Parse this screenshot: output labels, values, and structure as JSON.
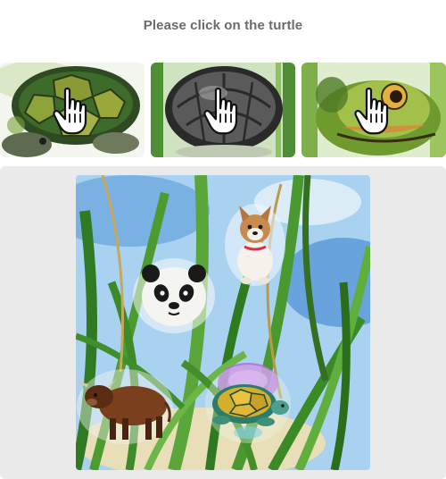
{
  "captcha": {
    "instruction": "Please click on the turtle"
  },
  "example_tiles": [
    {
      "icon": "turtle-shell-green-example",
      "cursor_icon": "hand-pointer-icon"
    },
    {
      "icon": "turtle-shell-grey-example",
      "cursor_icon": "hand-pointer-icon"
    },
    {
      "icon": "turtle-head-example",
      "cursor_icon": "hand-pointer-icon"
    }
  ],
  "scene": {
    "background": "watercolor-grass-sky",
    "animals": [
      {
        "kind": "dog",
        "icon": "dog-icon"
      },
      {
        "kind": "panda",
        "icon": "panda-icon"
      },
      {
        "kind": "cow",
        "icon": "cow-icon"
      },
      {
        "kind": "turtle",
        "icon": "turtle-icon"
      }
    ]
  },
  "colors": {
    "prompt_text": "#6b6b6b",
    "stage_bg": "#eaeaea",
    "sky": "#8ec3ec",
    "grass": "#3f8f2c",
    "turtle_glow": "#b46ae0"
  }
}
